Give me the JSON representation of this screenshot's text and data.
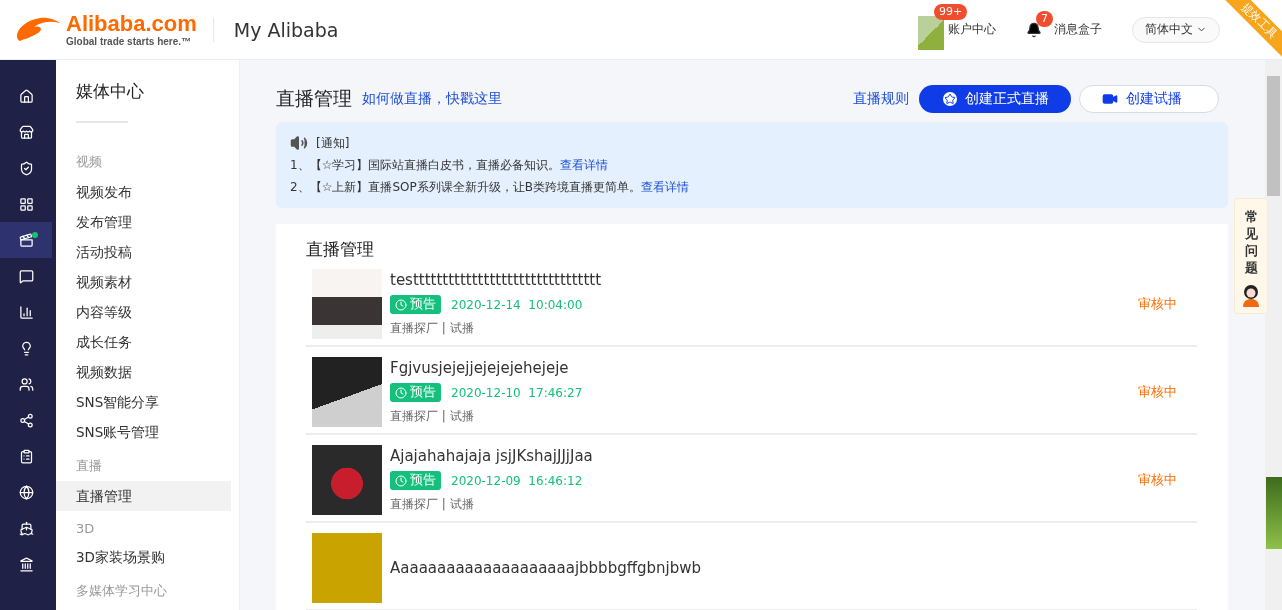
{
  "header": {
    "logo": {
      "name": "Alibaba.com",
      "tagline": "Global trade starts here.™"
    },
    "title": "My Alibaba",
    "account": {
      "label": "账户中心",
      "badge": "99+"
    },
    "messages": {
      "label": "消息盒子",
      "badge": "7"
    },
    "language": "简体中文",
    "ribbon": "提效工具"
  },
  "rail": [
    {
      "selected": false
    },
    {
      "selected": false
    },
    {
      "selected": false
    },
    {
      "selected": false
    },
    {
      "selected": true
    },
    {
      "selected": false
    },
    {
      "selected": false
    },
    {
      "selected": false
    },
    {
      "selected": false
    },
    {
      "selected": false
    },
    {
      "selected": false
    },
    {
      "selected": false
    },
    {
      "selected": false
    },
    {
      "selected": false
    }
  ],
  "sidebar": {
    "title": "媒体中心",
    "groups": [
      {
        "heading": "视频",
        "items": [
          {
            "label": "视频发布",
            "selected": false
          },
          {
            "label": "发布管理",
            "selected": false
          },
          {
            "label": "活动投稿",
            "selected": false
          },
          {
            "label": "视频素材",
            "selected": false
          },
          {
            "label": "内容等级",
            "selected": false
          },
          {
            "label": "成长任务",
            "selected": false
          },
          {
            "label": "视频数据",
            "selected": false
          },
          {
            "label": "SNS智能分享",
            "selected": false
          },
          {
            "label": "SNS账号管理",
            "selected": false
          }
        ]
      },
      {
        "heading": "直播",
        "items": [
          {
            "label": "直播管理",
            "selected": true
          }
        ]
      },
      {
        "heading": "3D",
        "items": [
          {
            "label": "3D家装场景购",
            "selected": false
          }
        ]
      },
      {
        "heading": "多媒体学习中心"
      }
    ]
  },
  "page": {
    "title": "直播管理",
    "help_link": "如何做直播，快戳这里",
    "rules_link": "直播规则",
    "primary_button": "创建正式直播",
    "secondary_button": "创建试播"
  },
  "notice": {
    "heading": "[通知]",
    "lines": [
      {
        "text": "1、【☆学习】国际站直播白皮书，直播必备知识。",
        "link": "查看详情"
      },
      {
        "text": "2、【☆上新】直播SOP系列课全新升级，让B类跨境直播更简单。",
        "link": "查看详情"
      }
    ]
  },
  "list": {
    "title": "直播管理",
    "rows": [
      {
        "title": "testttttttttttttttttttttttttttttttt",
        "tag": "预告",
        "date": "2020-12-14",
        "time": "10:04:00",
        "meta": "直播探厂 | 试播",
        "status": "审核中"
      },
      {
        "title": "Fgjvusjejejjejejejehejeje",
        "tag": "预告",
        "date": "2020-12-10",
        "time": "17:46:27",
        "meta": "直播探厂 | 试播",
        "status": "审核中"
      },
      {
        "title": "Ajajahahajaja jsjJKshajJJjJaa",
        "tag": "预告",
        "date": "2020-12-09",
        "time": "16:46:12",
        "meta": "直播探厂 | 试播",
        "status": "审核中"
      },
      {
        "title": "Aaaaaaaaaaaaaaaaaaaajbbbbgffgbnjbwb"
      }
    ]
  },
  "faq": "常见问题"
}
